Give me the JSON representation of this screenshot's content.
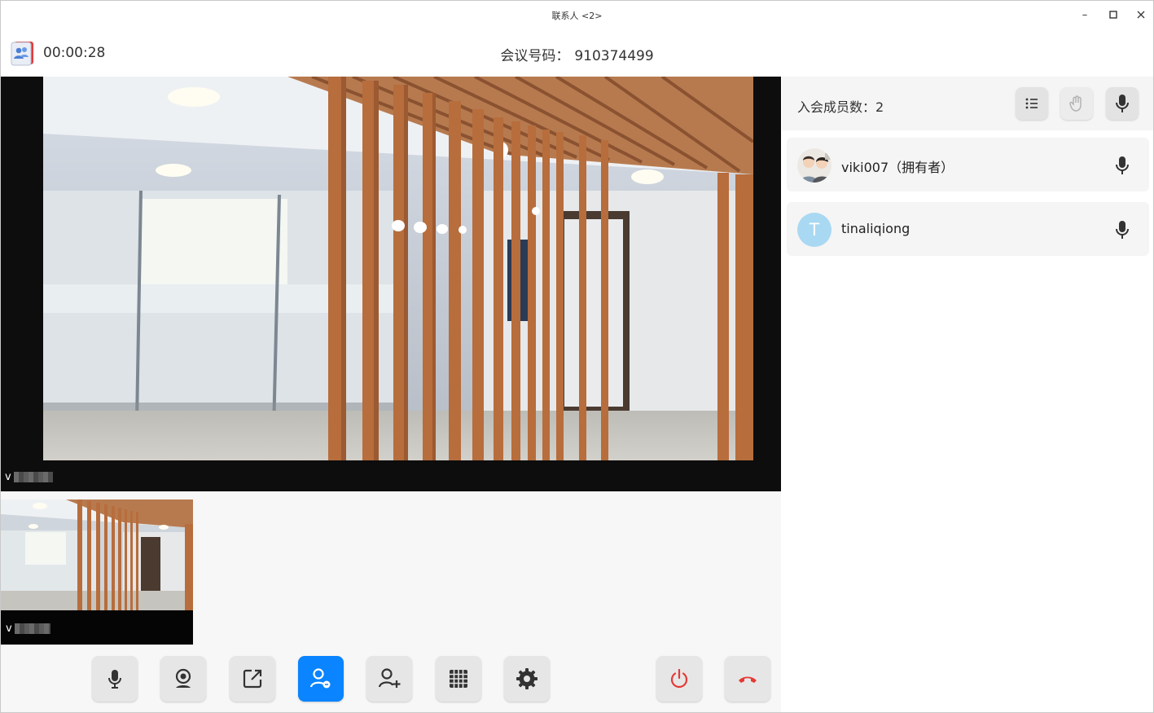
{
  "window": {
    "title": "联系人 <2>",
    "controls": {
      "minimize": "–",
      "maximize": "□",
      "close": "✕"
    }
  },
  "header": {
    "timer": "00:00:28",
    "meeting_label": "会议号码：",
    "meeting_number": "910374499"
  },
  "main_video": {
    "name_initial": "v"
  },
  "thumbnail": {
    "name_initial": "v"
  },
  "toolbar": {
    "buttons": [
      {
        "id": "mic",
        "icon": "microphone-icon",
        "active": false
      },
      {
        "id": "camera",
        "icon": "camera-icon",
        "active": false
      },
      {
        "id": "share-screen",
        "icon": "share-screen-icon",
        "active": false
      },
      {
        "id": "participants",
        "icon": "participants-icon",
        "active": true
      },
      {
        "id": "invite",
        "icon": "add-user-icon",
        "active": false
      },
      {
        "id": "layout",
        "icon": "grid-layout-icon",
        "active": false
      },
      {
        "id": "settings",
        "icon": "gear-icon",
        "active": false
      },
      {
        "id": "end-meeting",
        "icon": "power-icon",
        "active": false
      },
      {
        "id": "hang-up",
        "icon": "hang-up-icon",
        "active": false
      }
    ],
    "active_color": "#0a84ff",
    "danger_color": "#e53935"
  },
  "panel": {
    "member_count_label": "入会成员数：",
    "member_count": "2",
    "members": [
      {
        "name": "viki007（拥有者）",
        "avatar": "cartoon-avatar",
        "mic": "on"
      },
      {
        "name": "tinaliqiong",
        "avatar_letter": "T",
        "avatar_color": "#a9d8f2",
        "mic": "on"
      }
    ]
  }
}
